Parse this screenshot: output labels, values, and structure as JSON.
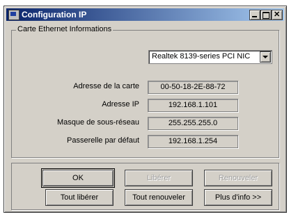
{
  "window": {
    "title": "Configuration IP"
  },
  "group": {
    "title": "Carte Ethernet Informations"
  },
  "adapter_select": {
    "selected": "Realtek 8139-series PCI NIC"
  },
  "info_rows": [
    {
      "label": "Adresse de la carte",
      "value": "00-50-18-2E-88-72"
    },
    {
      "label": "Adresse IP",
      "value": "192.168.1.101"
    },
    {
      "label": "Masque de sous-réseau",
      "value": "255.255.255.0"
    },
    {
      "label": "Passerelle par défaut",
      "value": "192.168.1.254"
    }
  ],
  "buttons": {
    "ok": "OK",
    "release": "Libérer",
    "renew": "Renouveler",
    "release_all": "Tout libérer",
    "renew_all": "Tout renouveler",
    "more_info": "Plus d'info >>"
  }
}
